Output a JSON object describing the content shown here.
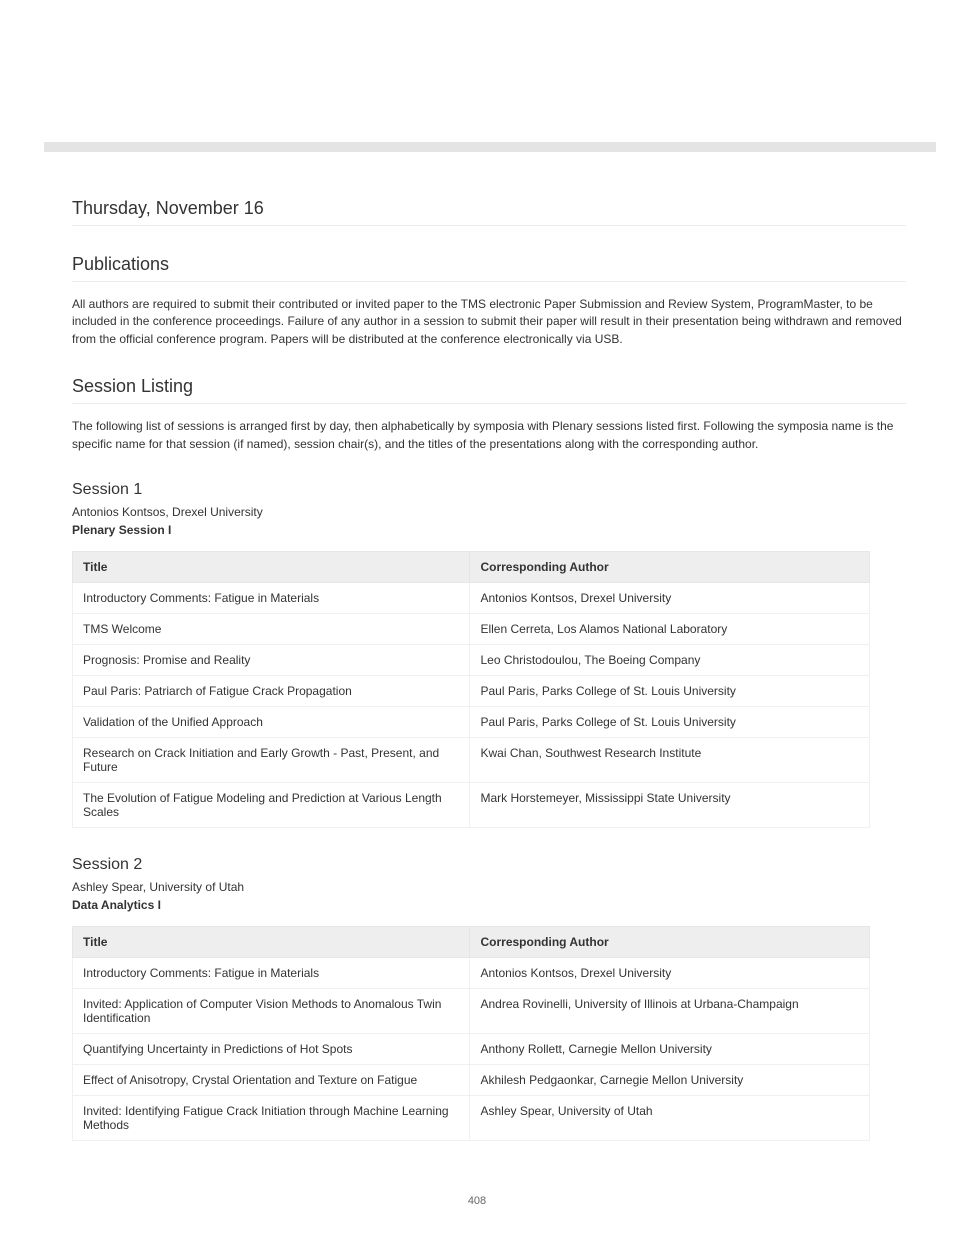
{
  "top_heading": "Thursday, November 16",
  "heading_publications": "Publications",
  "para1": "All authors are required to submit their contributed or invited paper to the TMS electronic Paper Submission and Review System, ProgramMaster, to be included in the conference proceedings. Failure of any author in a session to submit their paper will result in their presentation being withdrawn and removed from the official conference program. Papers will be distributed at the conference electronically via USB.",
  "heading_session_listing": "Session Listing",
  "para2": "The following list of sessions is arranged first by day, then alphabetically by symposia with Plenary sessions listed first. Following the symposia name is the specific name for that session (if named), session chair(s), and the titles of the presentations along with the corresponding author.",
  "session1": {
    "heading": "Session 1",
    "chair": "Antonios Kontsos, Drexel University",
    "title": "Plenary Session I",
    "table": {
      "col1": "Title",
      "col2": "Corresponding Author",
      "rows": [
        {
          "c1": "Introductory Comments: Fatigue in Materials",
          "c2": "Antonios Kontsos, Drexel University"
        },
        {
          "c1": "TMS Welcome",
          "c2": "Ellen Cerreta, Los Alamos National Laboratory"
        },
        {
          "c1": "Prognosis: Promise and Reality",
          "c2": "Leo Christodoulou, The Boeing Company"
        },
        {
          "c1": "Paul Paris: Patriarch of Fatigue Crack Propagation",
          "c2": "Paul Paris, Parks College of St. Louis University"
        },
        {
          "c1": "Validation of the Unified Approach",
          "c2": "Paul Paris, Parks College of St. Louis University"
        },
        {
          "c1": "Research on Crack Initiation and Early Growth - Past, Present, and Future",
          "c2": "Kwai Chan, Southwest Research Institute"
        },
        {
          "c1": "The Evolution of Fatigue Modeling and Prediction at Various Length Scales",
          "c2": "Mark Horstemeyer, Mississippi State University"
        }
      ]
    }
  },
  "session2": {
    "heading": "Session 2",
    "chair": "Ashley Spear, University of Utah",
    "title": "Data Analytics I",
    "table": {
      "col1": "Title",
      "col2": "Corresponding Author",
      "rows": [
        {
          "c1": "Introductory Comments: Fatigue in Materials",
          "c2": "Antonios Kontsos, Drexel University"
        },
        {
          "c1": "Invited: Application of Computer Vision Methods to Anomalous Twin Identification",
          "c2": "Andrea Rovinelli, University of Illinois at Urbana-Champaign"
        },
        {
          "c1": "Quantifying Uncertainty in Predictions of Hot Spots",
          "c2": "Anthony Rollett, Carnegie Mellon University"
        },
        {
          "c1": "Effect of Anisotropy, Crystal Orientation and Texture on Fatigue",
          "c2": "Akhilesh Pedgaonkar, Carnegie Mellon University"
        },
        {
          "c1": "Invited: Identifying Fatigue Crack Initiation through Machine Learning Methods",
          "c2": "Ashley Spear, University of Utah"
        }
      ]
    }
  },
  "page_number": "408"
}
